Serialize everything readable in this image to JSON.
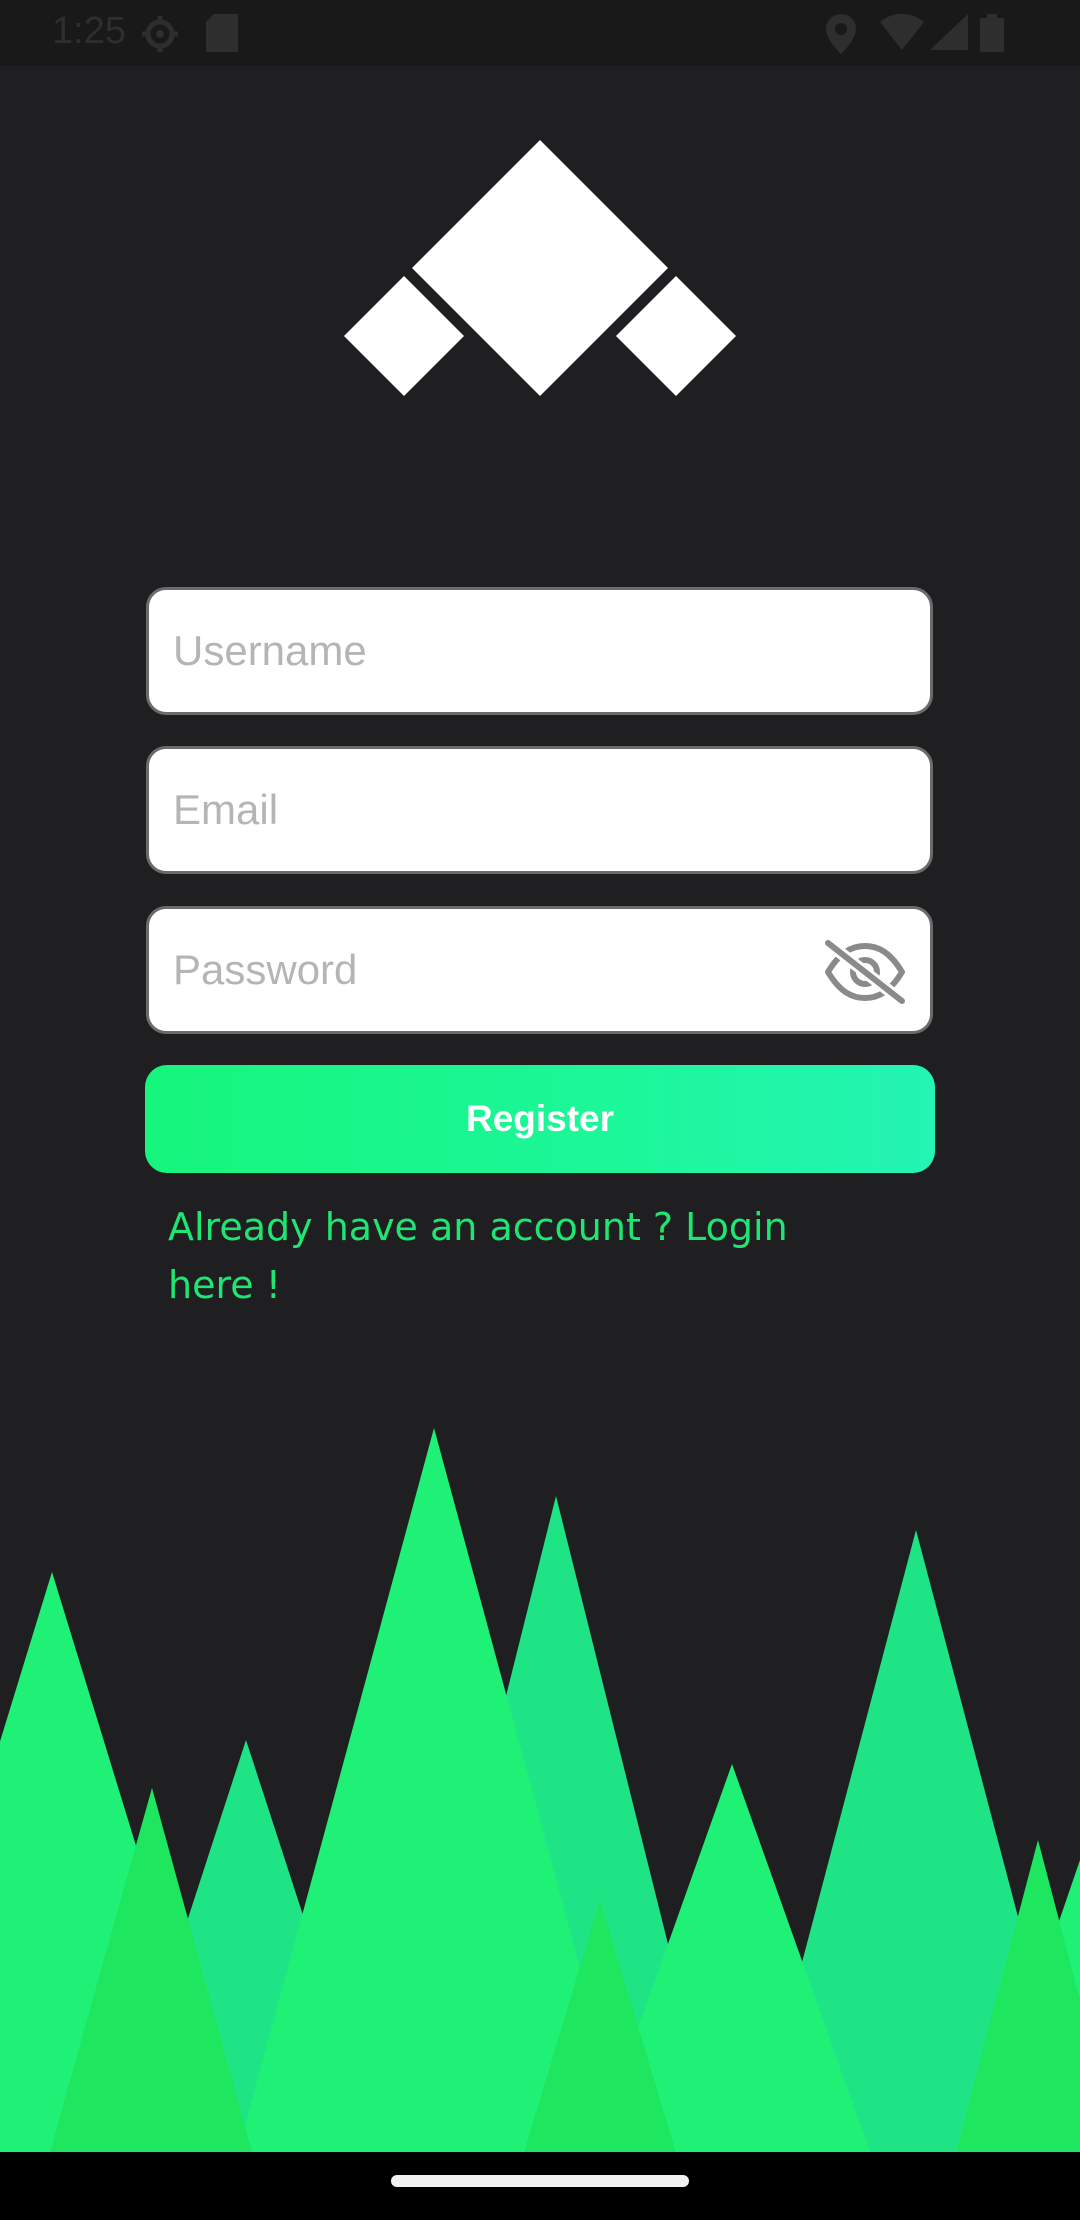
{
  "status_bar": {
    "time": "1:25",
    "icons": [
      "settings-icon",
      "sd-card-icon",
      "location-icon",
      "wifi-icon",
      "signal-icon",
      "battery-icon"
    ]
  },
  "logo": {
    "icon": "diamonds-logo"
  },
  "form": {
    "username_placeholder": "Username",
    "email_placeholder": "Email",
    "password_placeholder": "Password",
    "password_toggle_icon": "eye-off-icon",
    "register_label": "Register",
    "login_link": "Already have an account ? Login here !"
  },
  "colors": {
    "background": "#1f1f21",
    "accent_green": "#1fe673",
    "button_gradient_start": "#16f57c",
    "button_gradient_end": "#25f4b4"
  },
  "decoration": {
    "icon": "green-trees-illustration"
  }
}
